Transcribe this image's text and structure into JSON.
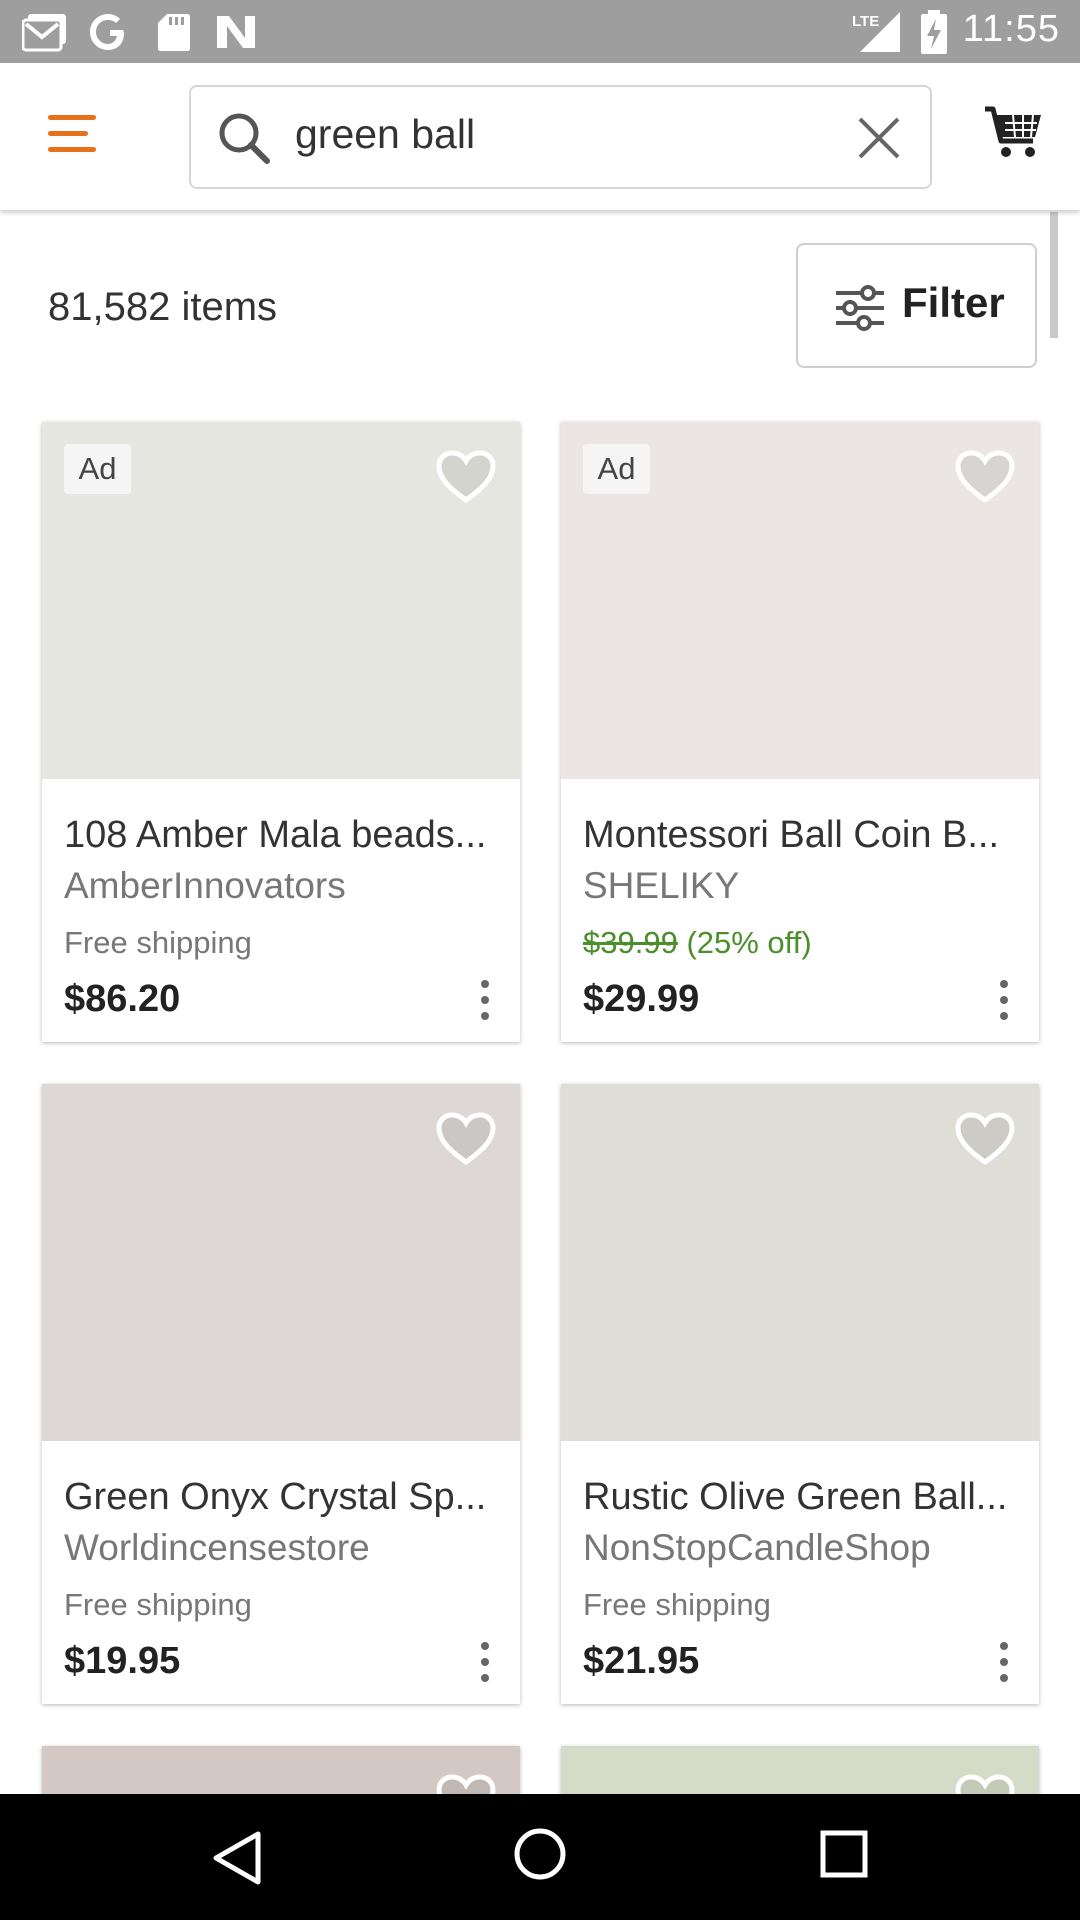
{
  "status_bar": {
    "time": "11:55",
    "left_icons": [
      "gmail-icon",
      "google-icon",
      "sd-card-icon",
      "n-icon"
    ],
    "right_icons": [
      "lte-signal-icon",
      "battery-charging-icon"
    ],
    "lte_label": "LTE"
  },
  "header": {
    "search": {
      "query": "green ball"
    },
    "menu_icon": "hamburger-menu-icon",
    "cart_icon": "cart-icon",
    "accent_color": "#e8701a"
  },
  "results": {
    "count": "81,582 items",
    "filter_label": "Filter"
  },
  "listings": [
    {
      "ad": "Ad",
      "title": "108 Amber Mala beads...",
      "shop": "AmberInnovators",
      "shipping": "Free shipping",
      "price": "$86.20",
      "image_color": "#e6e6e0"
    },
    {
      "ad": "Ad",
      "title": "Montessori Ball Coin B...",
      "shop": "SHELIKY",
      "original_price": "$39.99",
      "discount": "(25% off)",
      "price": "$29.99",
      "image_color": "#ebe6e3",
      "discount_color": "#4a8f2b"
    },
    {
      "title": "Green Onyx Crystal Sp...",
      "shop": "Worldincensestore",
      "shipping": "Free shipping",
      "price": "$19.95",
      "image_color": "#ddd8d6"
    },
    {
      "title": "Rustic Olive Green Ball...",
      "shop": "NonStopCandleShop",
      "shipping": "Free shipping",
      "price": "$21.95",
      "image_color": "#deddd6"
    },
    {
      "image_color": "#d3c8c3"
    },
    {
      "image_color": "#d4dcc8"
    }
  ],
  "nav_bar": {
    "icons": [
      "back-icon",
      "home-icon",
      "recents-icon"
    ]
  }
}
